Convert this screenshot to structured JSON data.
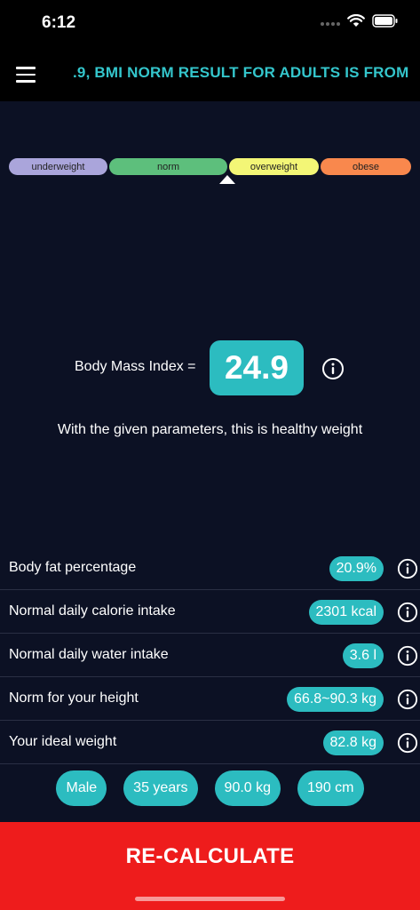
{
  "status_bar": {
    "time": "6:12"
  },
  "header": {
    "marquee": ".9, BMI NORM RESULT FOR ADULTS IS FROM"
  },
  "scale": {
    "segments": [
      "underweight",
      "norm",
      "overweight",
      "obese"
    ],
    "colors": {
      "underweight": "#aaa5db",
      "norm": "#5dbf7c",
      "overweight": "#f3f676",
      "obese": "#f9884d"
    }
  },
  "bmi": {
    "label": "Body Mass Index =",
    "value": "24.9",
    "description": "With the given parameters, this is healthy weight"
  },
  "results": [
    {
      "label": "Body fat percentage",
      "value": "20.9%"
    },
    {
      "label": "Normal daily calorie intake",
      "value": "2301 kcal"
    },
    {
      "label": "Normal daily water intake",
      "value": "3.6 l"
    },
    {
      "label": "Norm for your height",
      "value": "66.8~90.3 kg"
    },
    {
      "label": "Your ideal weight",
      "value": "82.8 kg"
    }
  ],
  "params": {
    "gender": "Male",
    "age": "35 years",
    "weight": "90.0 kg",
    "height": "190 cm"
  },
  "recalculate_label": "RE-CALCULATE",
  "colors": {
    "accent": "#2cbcc0",
    "background": "#0c1124",
    "cta": "#ee1c1c",
    "marquee": "#34c6cc"
  }
}
